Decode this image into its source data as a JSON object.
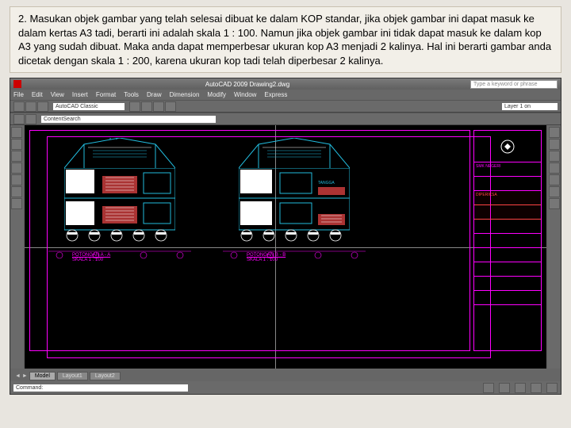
{
  "instruction": {
    "number": "2.",
    "text": "Masukan objek gambar yang telah selesai dibuat ke dalam KOP standar, jika objek gambar ini dapat masuk ke dalam kertas A3 tadi, berarti ini adalah skala 1 : 100. Namun jika objek gambar ini tidak dapat masuk ke dalam kop A3 yang sudah dibuat. Maka anda dapat memperbesar ukuran kop A3 menjadi 2 kalinya. Hal ini berarti gambar anda dicetak dengan skala 1 : 200, karena ukuran kop tadi telah diperbesar 2 kalinya."
  },
  "cad": {
    "app_title": "AutoCAD 2009 Drawing2.dwg",
    "search_placeholder": "Type a keyword or phrase",
    "menu": [
      "File",
      "Edit",
      "View",
      "Insert",
      "Format",
      "Tools",
      "Draw",
      "Dimension",
      "Modify",
      "Window",
      "Express"
    ],
    "workspace": "AutoCAD Classic",
    "layer": "Layer 1 on",
    "command_prompt": "Command:",
    "tabs": [
      "Model",
      "Layout1",
      "Layout2"
    ],
    "status_coord": "",
    "section_a": {
      "title": "POTONGAN A - A",
      "scale": "SKALA 1 : 100"
    },
    "section_b": {
      "title": "POTONGAN B - B",
      "scale": "SKALA 1 : 100"
    },
    "titleblock": {
      "school": "SMK NEGERI",
      "project": "DIPERIKSA",
      "rows": [
        "",
        "",
        "",
        "",
        ""
      ]
    },
    "colors": {
      "kop": "#ff00ff",
      "arch": "#22bbdd",
      "stair": "#aa3333"
    }
  }
}
